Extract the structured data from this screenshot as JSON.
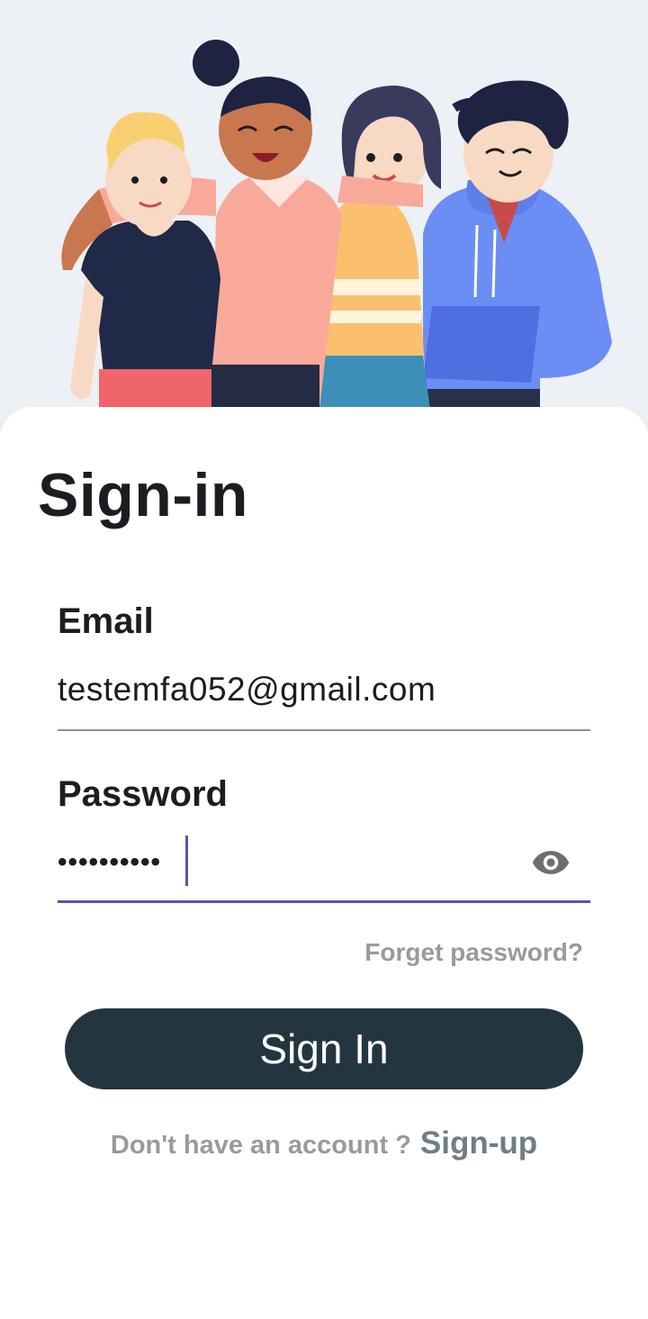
{
  "hero": {
    "illustration": "group-of-friends-illustration"
  },
  "form": {
    "title": "Sign-in",
    "email": {
      "label": "Email",
      "value": "testemfa052@gmail.com"
    },
    "password": {
      "label": "Password",
      "value": "••••••••••",
      "toggle_icon": "eye-icon"
    },
    "forget_password": "Forget password?",
    "submit_label": "Sign In",
    "signup_prompt": "Don't have an account ?",
    "signup_link": "Sign-up"
  },
  "colors": {
    "button_bg": "#233640",
    "focus_accent": "#6750a4",
    "hero_bg": "#edf0f4"
  }
}
